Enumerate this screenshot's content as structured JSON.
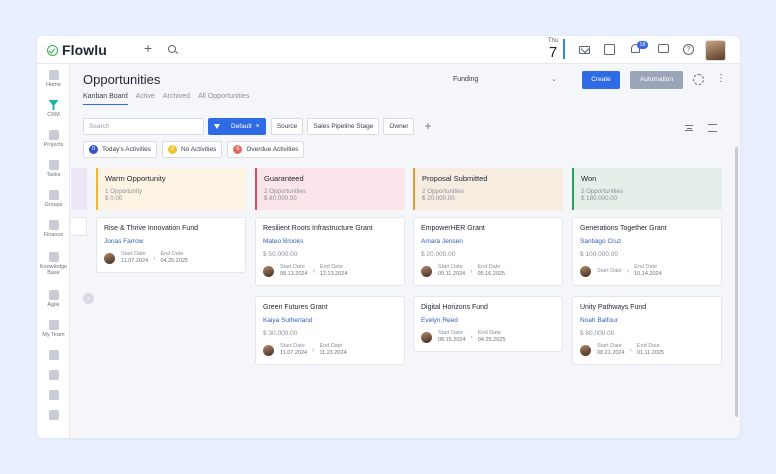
{
  "app": {
    "name": "Flowlu"
  },
  "topbar": {
    "date_day": "Thu",
    "date_num": "7",
    "notifications_count": "18"
  },
  "sidebar": {
    "items": [
      {
        "label": "Home",
        "icon": "home-icon"
      },
      {
        "label": "CRM",
        "icon": "crm-icon",
        "active": true
      },
      {
        "label": "Projects",
        "icon": "projects-icon"
      },
      {
        "label": "Tasks",
        "icon": "tasks-icon"
      },
      {
        "label": "Groups",
        "icon": "groups-icon"
      },
      {
        "label": "Finance",
        "icon": "finance-icon"
      },
      {
        "label": "Knowledge Base",
        "icon": "knowledge-base-icon"
      },
      {
        "label": "Agile",
        "icon": "agile-icon"
      },
      {
        "label": "My Team",
        "icon": "team-icon"
      },
      {
        "label": "",
        "icon": "app-icon"
      },
      {
        "label": "",
        "icon": "app-icon"
      },
      {
        "label": "",
        "icon": "app-icon"
      },
      {
        "label": "",
        "icon": "app-icon"
      }
    ]
  },
  "header": {
    "title": "Opportunities",
    "pipeline_select": "Funding",
    "create_label": "Create",
    "automation_label": "Automation"
  },
  "tabs": [
    "Kanban Board",
    "Active",
    "Archived",
    "All Opportunities"
  ],
  "filters": {
    "search_placeholder": "Search",
    "default_label": "Default",
    "chips": [
      "Source",
      "Sales Pipeline Stage",
      "Owner"
    ]
  },
  "activities": [
    {
      "count": "0",
      "label": "Today's Activities",
      "color": "#3455c7"
    },
    {
      "count": "2",
      "label": "No Activities",
      "color": "#f2c230"
    },
    {
      "count": "6",
      "label": "Overdue Activities",
      "color": "#e46b61"
    }
  ],
  "columns": [
    {
      "name": "Warm Opportunity",
      "count": "1 Opportunity",
      "total": "$ 0,00",
      "bg": "#fdf3e2",
      "accent": "#f2b632",
      "cards": [
        {
          "name": "Rise & Thrive Innovation Fund",
          "person": "Jonas Farrow",
          "amount": "",
          "start": "11.07.2024",
          "end": "04.25.2025"
        }
      ]
    },
    {
      "name": "Guaranteed",
      "count": "2 Opportunities",
      "total": "$ 80,000.00",
      "bg": "#fbe4ea",
      "accent": "#e14a5a",
      "cards": [
        {
          "name": "Resilient Roots Infrastructure Grant",
          "person": "Mateo Brooks",
          "amount": "$ 50,000.00",
          "start": "08.13.2024",
          "end": "12.13.2024"
        },
        {
          "name": "Green Futures Grant",
          "person": "Kaiya Sutherland",
          "amount": "$ 30,000.00",
          "start": "11.07.2024",
          "end": "11.23.2024"
        }
      ]
    },
    {
      "name": "Proposal Submitted",
      "count": "2 Opportunities",
      "total": "$ 20,000.00",
      "bg": "#f6ece0",
      "accent": "#e39b3a",
      "cards": [
        {
          "name": "EmpowerHER Grant",
          "person": "Amara Jensen",
          "amount": "$ 20,000.00",
          "start": "09.11.2024",
          "end": "05.16.2025"
        },
        {
          "name": "Digital Horizons Fund",
          "person": "Evelyn Reed",
          "amount": "",
          "start": "08.15.2024",
          "end": "04.25.2025"
        }
      ]
    },
    {
      "name": "Won",
      "count": "2 Opportunities",
      "total": "$ 180,000.00",
      "bg": "#e4efe9",
      "accent": "#2e9b63",
      "cards": [
        {
          "name": "Generations Together Grant",
          "person": "Santiago Cruz",
          "amount": "$ 100,000.00",
          "start": "",
          "end": "10.14.2024"
        },
        {
          "name": "Unity Pathways Fund",
          "person": "Noah Balfour",
          "amount": "$ 80,000.00",
          "start": "08.21.2024",
          "end": "01.11.2025"
        }
      ]
    }
  ],
  "labels": {
    "start_date": "Start Date",
    "end_date": "End Date"
  }
}
